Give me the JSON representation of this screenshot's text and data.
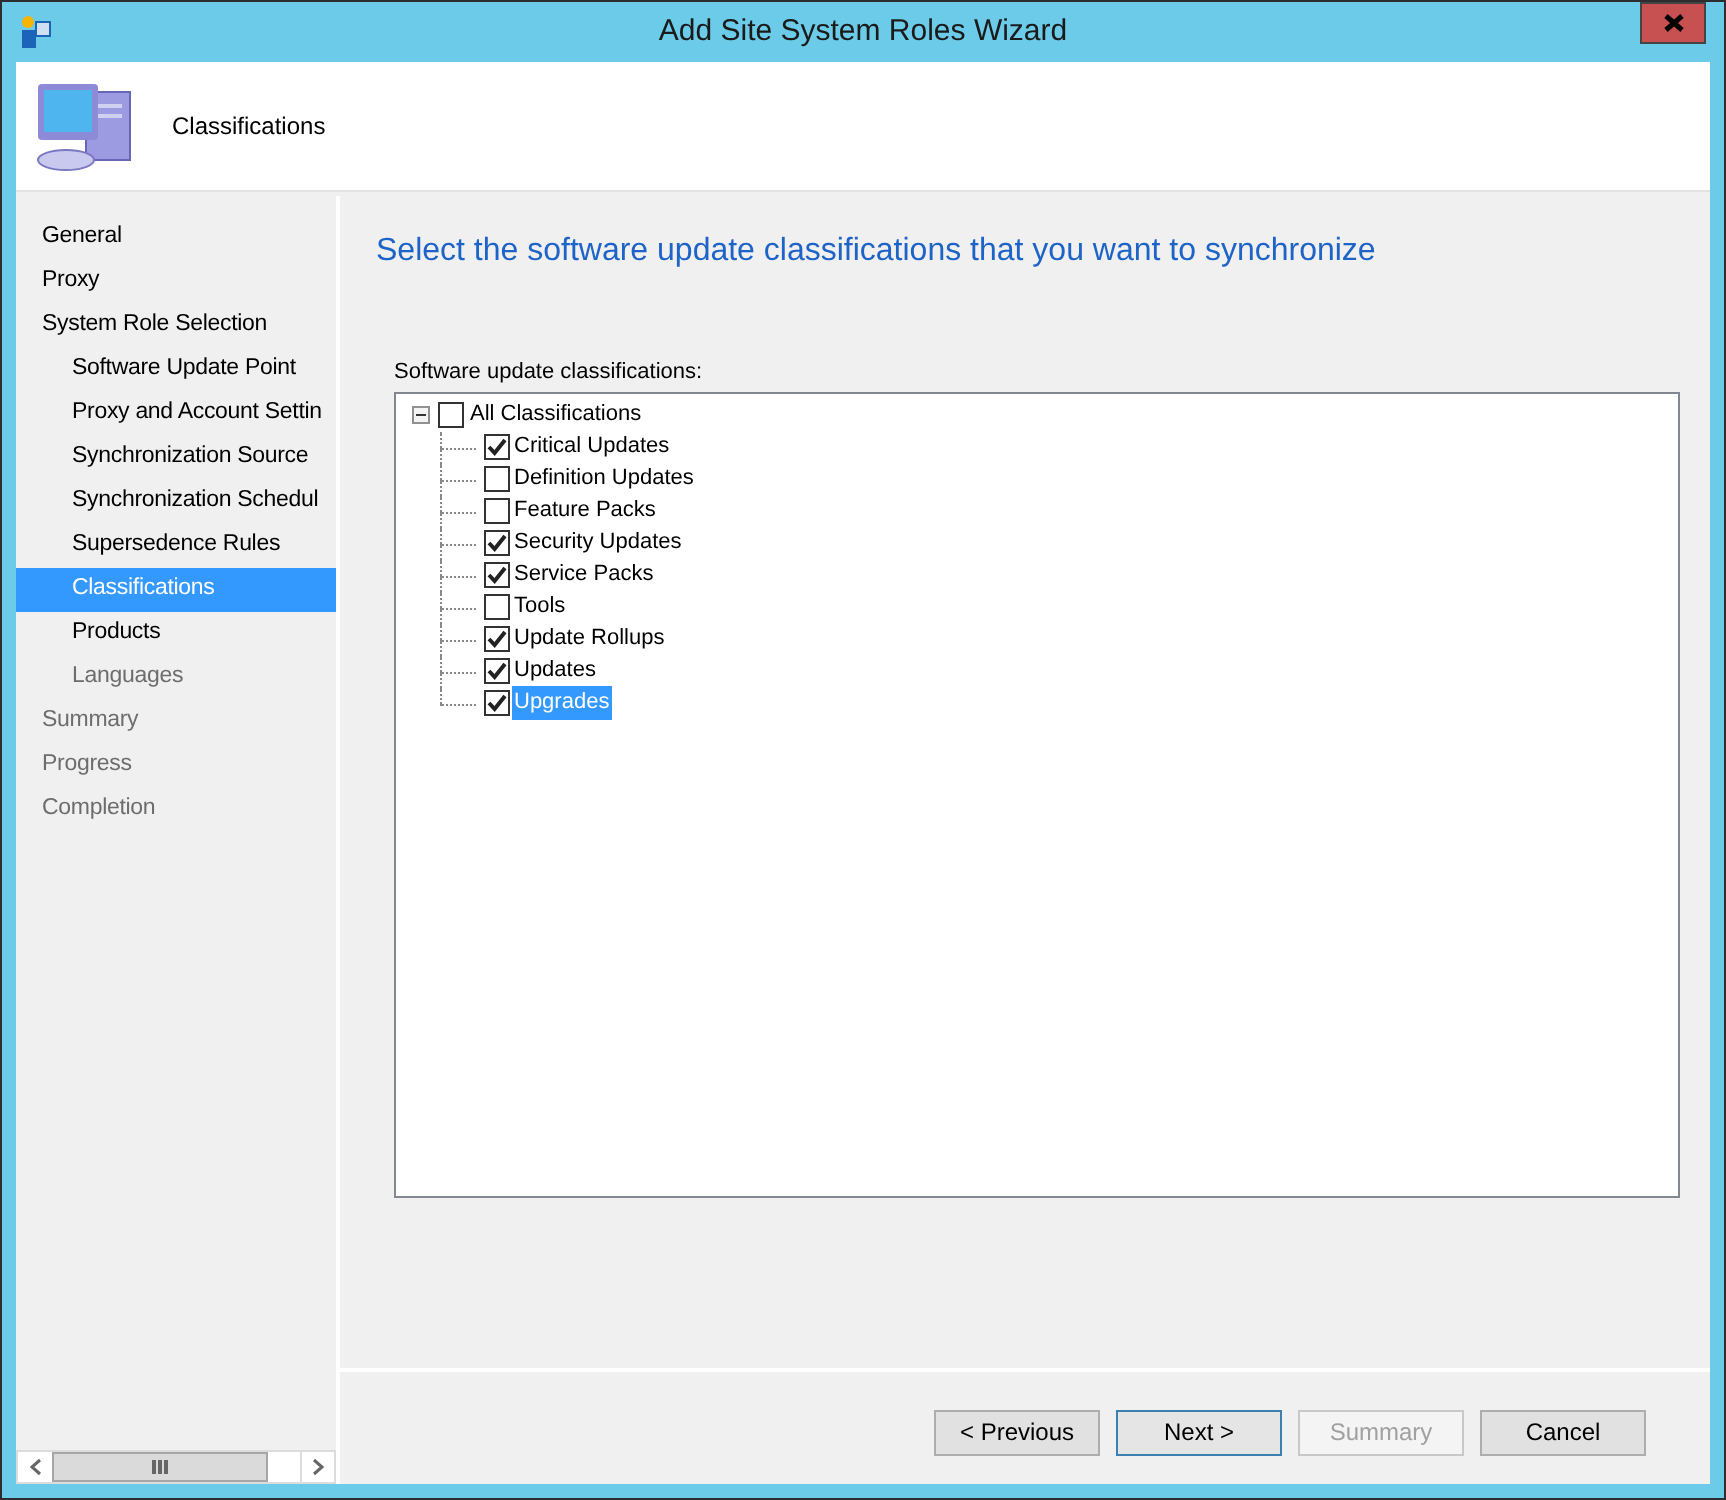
{
  "window": {
    "title": "Add Site System Roles Wizard"
  },
  "header": {
    "title": "Classifications"
  },
  "nav": [
    {
      "label": "General",
      "selected": false,
      "disabled": false
    },
    {
      "label": "Proxy",
      "selected": false,
      "disabled": false
    },
    {
      "label": "System Role Selection",
      "selected": false,
      "disabled": false,
      "children": [
        {
          "label": "Software Update Point",
          "selected": false,
          "disabled": false
        },
        {
          "label": "Proxy and Account Settin",
          "selected": false,
          "disabled": false
        },
        {
          "label": "Synchronization Source",
          "selected": false,
          "disabled": false
        },
        {
          "label": "Synchronization Schedul",
          "selected": false,
          "disabled": false
        },
        {
          "label": "Supersedence Rules",
          "selected": false,
          "disabled": false
        },
        {
          "label": "Classifications",
          "selected": true,
          "disabled": false
        },
        {
          "label": "Products",
          "selected": false,
          "disabled": false
        },
        {
          "label": "Languages",
          "selected": false,
          "disabled": true
        }
      ]
    },
    {
      "label": "Summary",
      "selected": false,
      "disabled": true
    },
    {
      "label": "Progress",
      "selected": false,
      "disabled": true
    },
    {
      "label": "Completion",
      "selected": false,
      "disabled": true
    }
  ],
  "heading": "Select the software update classifications that you want to synchronize",
  "tree_label": {
    "text": "Software update classifications:"
  },
  "tree": {
    "label": "All Classifications",
    "checked": false,
    "expanded": true,
    "selected": false,
    "children": [
      {
        "label": "Critical Updates",
        "checked": true,
        "selected": false
      },
      {
        "label": "Definition Updates",
        "checked": false,
        "selected": false
      },
      {
        "label": "Feature Packs",
        "checked": false,
        "selected": false
      },
      {
        "label": "Security Updates",
        "checked": true,
        "selected": false
      },
      {
        "label": "Service Packs",
        "checked": true,
        "selected": false
      },
      {
        "label": "Tools",
        "checked": false,
        "selected": false
      },
      {
        "label": "Update Rollups",
        "checked": true,
        "selected": false
      },
      {
        "label": "Updates",
        "checked": true,
        "selected": false
      },
      {
        "label": "Upgrades",
        "checked": true,
        "selected": true
      }
    ]
  },
  "buttons": [
    {
      "label": "< Previous",
      "disabled": false,
      "default": false
    },
    {
      "label": "Next >",
      "disabled": false,
      "default": true
    },
    {
      "label": "Summary",
      "disabled": true,
      "default": false
    },
    {
      "label": "Cancel",
      "disabled": false,
      "default": false
    }
  ]
}
